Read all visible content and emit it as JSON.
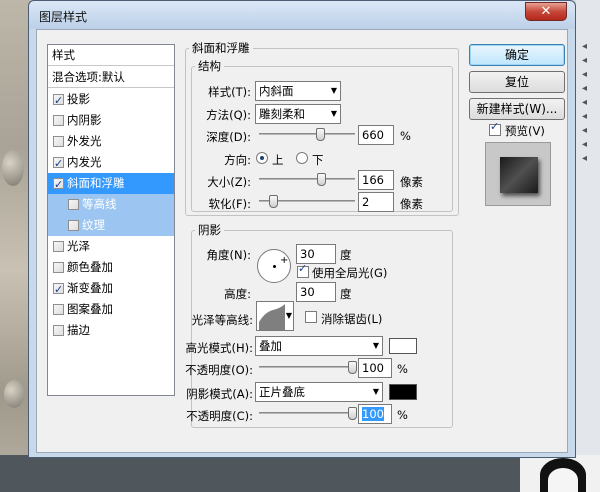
{
  "dialog": {
    "title": "图层样式",
    "close_label": "✕"
  },
  "style_list": {
    "header": "样式",
    "blend_options": "混合选项:默认",
    "items": [
      {
        "label": "投影",
        "checked": true
      },
      {
        "label": "内阴影",
        "checked": false
      },
      {
        "label": "外发光",
        "checked": false
      },
      {
        "label": "内发光",
        "checked": true
      },
      {
        "label": "斜面和浮雕",
        "checked": true,
        "selected": true
      },
      {
        "label": "等高线",
        "checked": false,
        "sub": true
      },
      {
        "label": "纹理",
        "checked": false,
        "sub": true
      },
      {
        "label": "光泽",
        "checked": false
      },
      {
        "label": "颜色叠加",
        "checked": false
      },
      {
        "label": "渐变叠加",
        "checked": true
      },
      {
        "label": "图案叠加",
        "checked": false
      },
      {
        "label": "描边",
        "checked": false
      }
    ]
  },
  "bevel": {
    "section_title": "斜面和浮雕",
    "structure_title": "结构",
    "style_label": "样式(T):",
    "style_value": "内斜面",
    "technique_label": "方法(Q):",
    "technique_value": "雕刻柔和",
    "depth_label": "深度(D):",
    "depth_value": "660",
    "depth_unit": "%",
    "depth_fraction": 0.66,
    "direction_label": "方向:",
    "direction_up": "上",
    "direction_down": "下",
    "size_label": "大小(Z):",
    "size_value": "166",
    "size_unit": "像素",
    "size_fraction": 0.67,
    "soften_label": "软化(F):",
    "soften_value": "2",
    "soften_unit": "像素",
    "soften_fraction": 0.12
  },
  "shading": {
    "title": "阴影",
    "angle_label": "角度(N):",
    "angle_value": "30",
    "angle_unit": "度",
    "global_light_label": "使用全局光(G)",
    "altitude_label": "高度:",
    "altitude_value": "30",
    "altitude_unit": "度",
    "gloss_contour_label": "光泽等高线:",
    "anti_alias_label": "消除锯齿(L)",
    "highlight_mode_label": "高光模式(H):",
    "highlight_mode_value": "叠加",
    "highlight_color": "#ffffff",
    "highlight_opacity_label": "不透明度(O):",
    "highlight_opacity_value": "100",
    "highlight_opacity_unit": "%",
    "shadow_mode_label": "阴影模式(A):",
    "shadow_mode_value": "正片叠底",
    "shadow_color": "#000000",
    "shadow_opacity_label": "不透明度(C):",
    "shadow_opacity_value": "100",
    "shadow_opacity_unit": "%"
  },
  "buttons": {
    "ok": "确定",
    "reset": "复位",
    "new_style": "新建样式(W)...",
    "preview_label": "预览(V)"
  }
}
